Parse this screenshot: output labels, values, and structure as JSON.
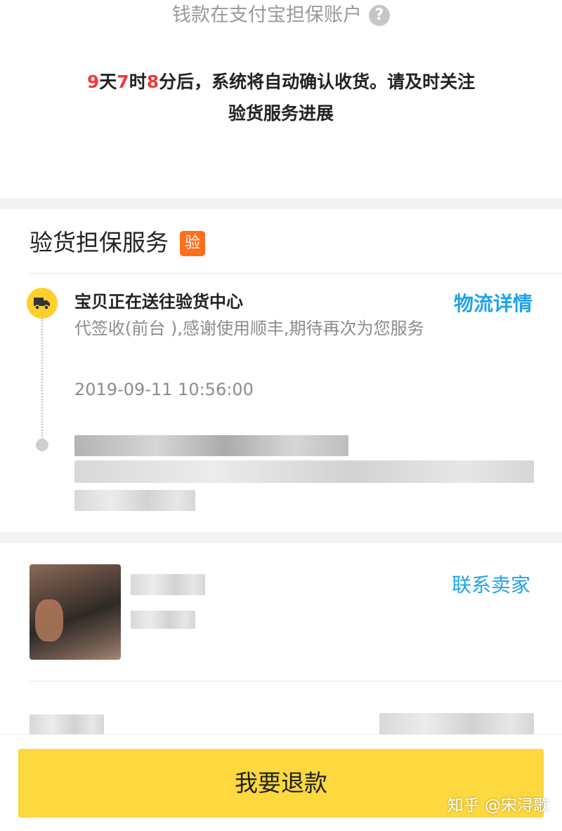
{
  "escrow": {
    "text": "钱款在支付宝担保账户",
    "help_icon": "?"
  },
  "countdown": {
    "days": "9",
    "days_unit": "天",
    "hours": "7",
    "hours_unit": "时",
    "minutes": "8",
    "minutes_unit": "分后，系统将自动确认收货。请及时关注",
    "line2": "验货服务进展"
  },
  "inspection": {
    "title": "验货担保服务",
    "badge": "验",
    "logistics_link": "物流详情",
    "event": {
      "title": "宝贝正在送往验货中心",
      "description": "代签收(前台 ),感谢使用顺丰,期待再次为您服务",
      "time": "2019-09-11 10:56:00"
    }
  },
  "seller": {
    "contact_link": "联系卖家"
  },
  "actions": {
    "refund_button": "我要退款"
  },
  "watermark": "知乎 @宋浔歌",
  "colors": {
    "accent_blue": "#1ea4e8",
    "countdown_red": "#ef3a3a",
    "button_yellow": "#fdd83e",
    "badge_orange": "#ff6e1a",
    "truck_yellow": "#ffcf2e"
  },
  "icons": {
    "truck": "truck-icon",
    "help": "help-icon"
  }
}
